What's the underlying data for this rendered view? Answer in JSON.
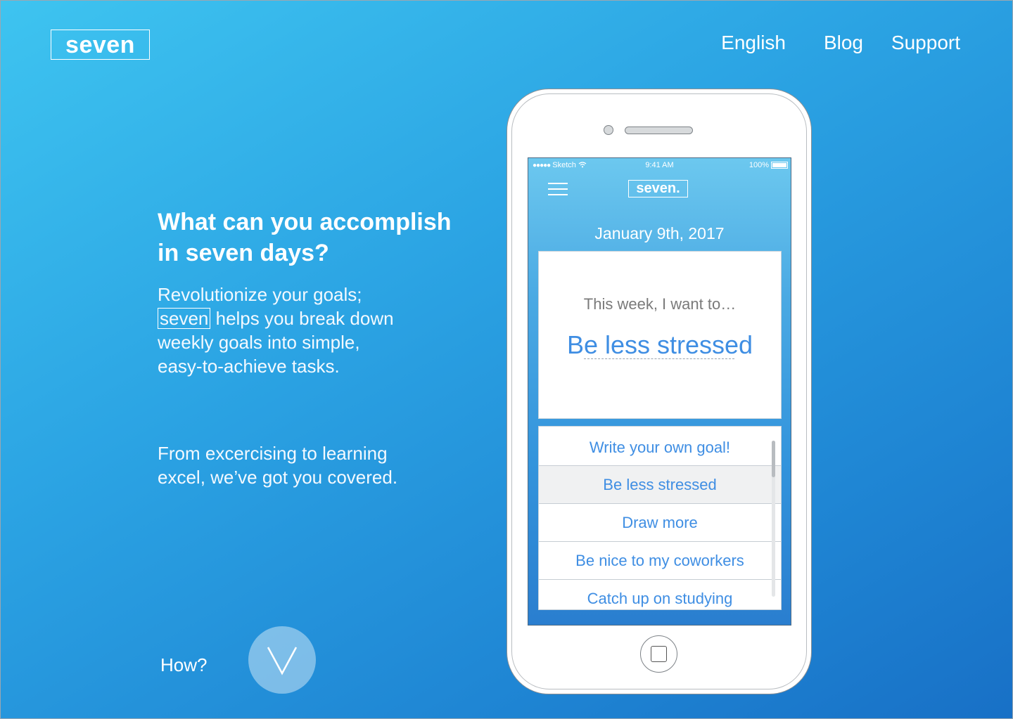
{
  "header": {
    "logo": "seven",
    "nav": {
      "english": "English",
      "blog": "Blog",
      "support": "Support"
    }
  },
  "hero": {
    "headline_line1": "What can you accomplish",
    "headline_line2": "in seven days?",
    "body1_line1": "Revolutionize your goals;",
    "body1_inline_logo": "seven",
    "body1_line2_rest": " helps you break down",
    "body1_line3": "weekly goals into simple,",
    "body1_line4": "easy-to-achieve tasks.",
    "body2_line1": "From excercising to learning",
    "body2_line2": "excel, we’ve got you covered.",
    "how_label": "How?",
    "how_icon": "chevron-down-icon"
  },
  "phone": {
    "status": {
      "carrier": "Sketch",
      "time": "9:41 AM",
      "battery": "100%"
    },
    "app_logo": "seven.",
    "date": "January 9th, 2017",
    "goal_prompt": "This week, I want to…",
    "goal_value": "Be less stressed",
    "options": [
      "Write your own goal!",
      "Be less stressed",
      "Draw more",
      "Be nice to my coworkers",
      "Catch up on studying"
    ],
    "selected_option": "Be less stressed"
  },
  "colors": {
    "gradient_start": "#3ec4f0",
    "gradient_end": "#1870c6",
    "accent_text": "#3f8ee3"
  }
}
